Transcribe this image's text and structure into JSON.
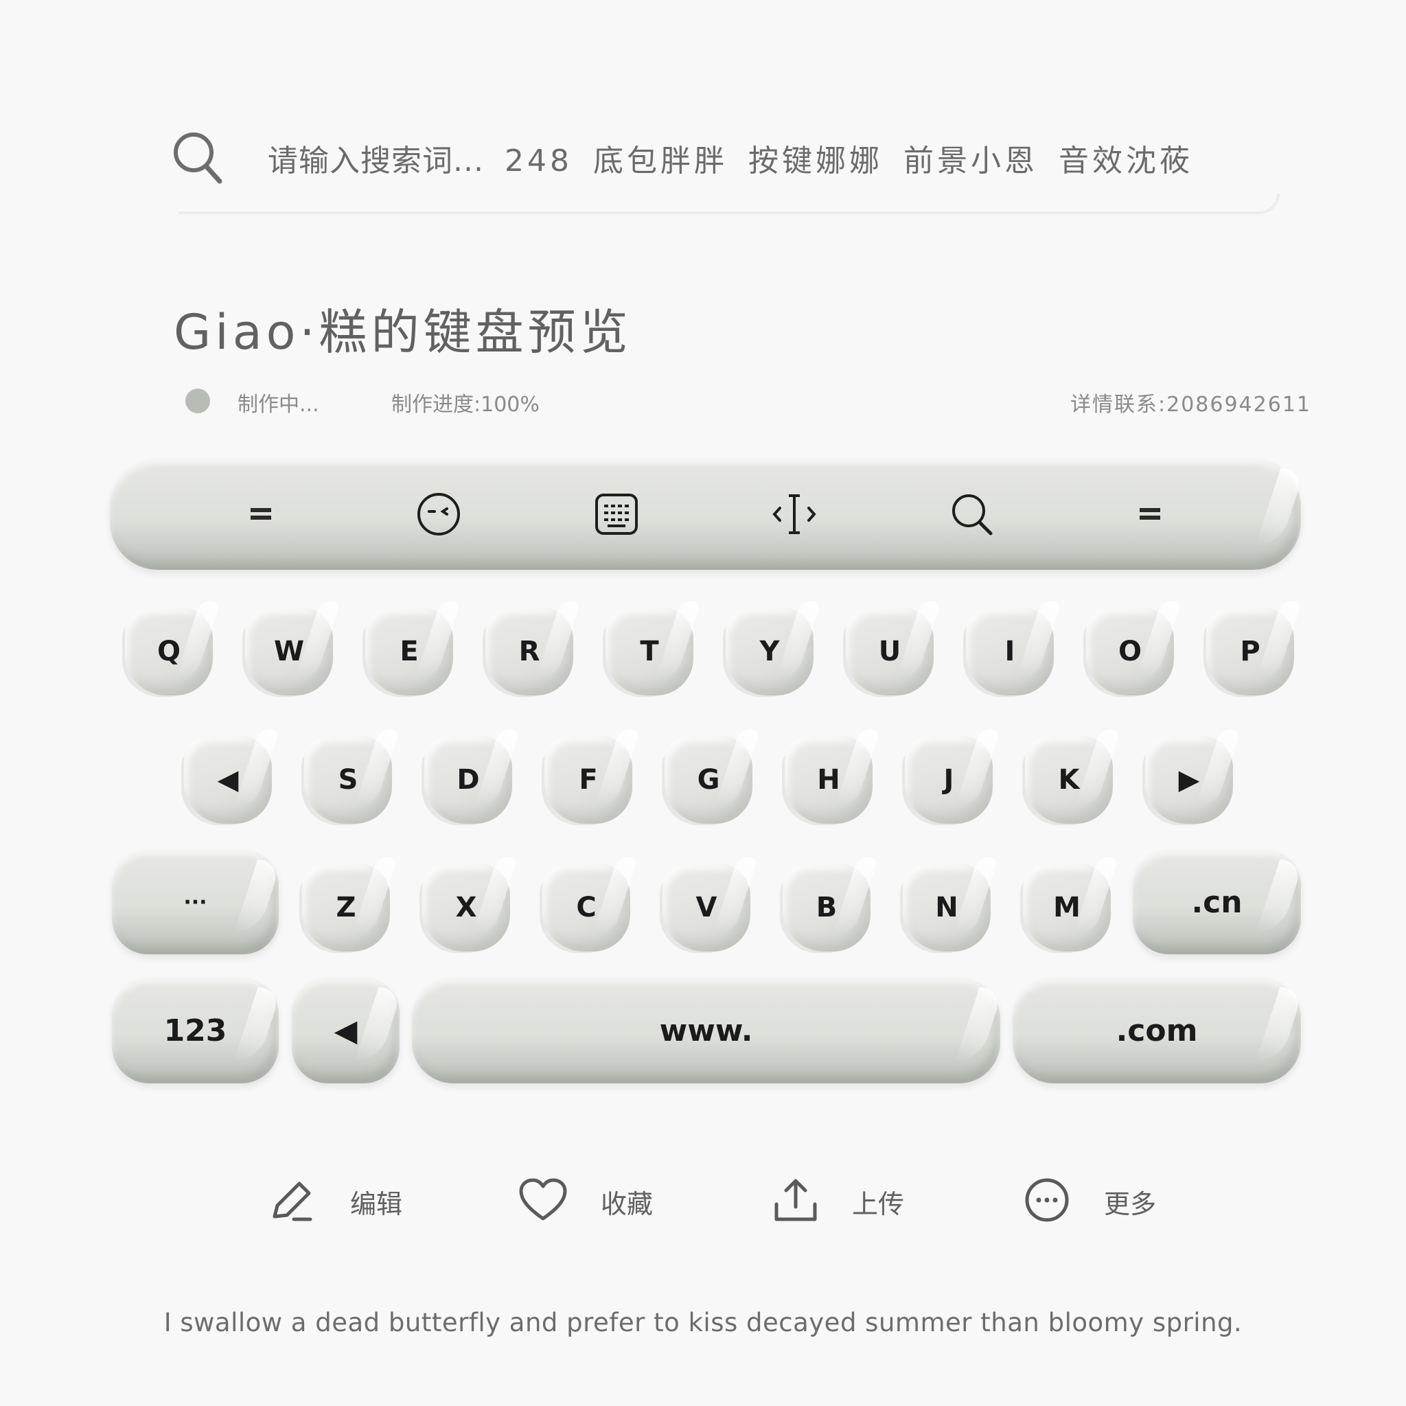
{
  "search": {
    "placeholder": "请输入搜索词...",
    "keywords": [
      "248",
      "底包胖胖",
      "按键娜娜",
      "前景小恩",
      "音效沈莜"
    ]
  },
  "title": "Giao·糕的键盘预览",
  "status": {
    "state": "制作中...",
    "progress_label": "制作进度:100%",
    "progress": 1.0,
    "contact": "详情联系:2086942611",
    "dot_color": "#b7bcb5"
  },
  "keyboard": {
    "toolbar_icons": [
      "menu-icon",
      "emoji-face-icon",
      "keyboard-icon",
      "cursor-move-icon",
      "search-icon",
      "menu-icon"
    ],
    "row1": [
      "Q",
      "W",
      "E",
      "R",
      "T",
      "Y",
      "U",
      "I",
      "O",
      "P"
    ],
    "row2": [
      "◀",
      "S",
      "D",
      "F",
      "G",
      "H",
      "J",
      "K",
      "▶"
    ],
    "row3": [
      "Z",
      "X",
      "C",
      "V",
      "B",
      "N",
      "M"
    ],
    "more_key": "···",
    "cn_key": ".cn",
    "num_key": "123",
    "back_key": "◀",
    "space_key": "www.",
    "com_key": ".com",
    "accent_color": "#c9ccc6"
  },
  "actions": [
    {
      "icon": "edit-icon",
      "label": "编辑"
    },
    {
      "icon": "heart-icon",
      "label": "收藏"
    },
    {
      "icon": "upload-icon",
      "label": "上传"
    },
    {
      "icon": "more-icon",
      "label": "更多"
    }
  ],
  "footer": {
    "quote": "I swallow a dead butterfly and prefer to kiss decayed summer than bloomy spring."
  }
}
